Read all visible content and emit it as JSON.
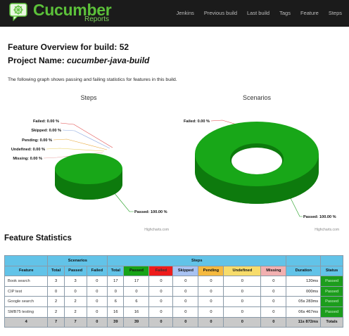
{
  "header": {
    "logo_title": "Cucumber",
    "logo_subtitle": "Reports",
    "nav": [
      "Jenkins",
      "Previous build",
      "Last build",
      "Tags",
      "Feature",
      "Steps"
    ]
  },
  "overview": {
    "build_heading": "Feature Overview for build: 52",
    "project_label": "Project Name: ",
    "project_name": "cucumber-java-build",
    "description": "The following graph shows passing and failing statistics for features in this build."
  },
  "charts": {
    "steps_title": "Steps",
    "scenarios_title": "Scenarios",
    "credit": "Highcharts.com",
    "steps_labels": {
      "failed": "Failed: 0.00 %",
      "skipped": "Skipped: 0.00 %",
      "pending": "Pending: 0.00 %",
      "undefined": "Undefined: 0.00 %",
      "missing": "Missing: 0.00 %",
      "passed": "Passed: 100.00 %"
    },
    "scenarios_labels": {
      "failed": "Failed: 0.00 %",
      "passed": "Passed: 100.00 %"
    }
  },
  "chart_data": [
    {
      "type": "pie",
      "title": "Steps",
      "categories": [
        "Failed",
        "Skipped",
        "Pending",
        "Undefined",
        "Missing",
        "Passed"
      ],
      "values": [
        0.0,
        0.0,
        0.0,
        0.0,
        0.0,
        100.0
      ],
      "unit": "%"
    },
    {
      "type": "pie",
      "title": "Scenarios",
      "categories": [
        "Failed",
        "Passed"
      ],
      "values": [
        0.0,
        100.0
      ],
      "unit": "%"
    }
  ],
  "stats": {
    "heading": "Feature Statistics",
    "group_headers": {
      "scenarios": "Scenarios",
      "steps": "Steps"
    },
    "columns": {
      "feature": "Feature",
      "sc_total": "Total",
      "sc_passed": "Passed",
      "sc_failed": "Failed",
      "st_total": "Total",
      "st_passed": "Passed",
      "st_failed": "Failed",
      "st_skipped": "Skipped",
      "st_pending": "Pending",
      "st_undefined": "Undefined",
      "st_missing": "Missing",
      "duration": "Duration",
      "status": "Status"
    },
    "rows": [
      {
        "feature": "Book search",
        "sc_total": "3",
        "sc_passed": "3",
        "sc_failed": "0",
        "st_total": "17",
        "st_passed": "17",
        "st_failed": "0",
        "st_skipped": "0",
        "st_pending": "0",
        "st_undefined": "0",
        "st_missing": "0",
        "duration": "120ms",
        "status": "Passed"
      },
      {
        "feature": "CIP test",
        "sc_total": "0",
        "sc_passed": "0",
        "sc_failed": "0",
        "st_total": "0",
        "st_passed": "0",
        "st_failed": "0",
        "st_skipped": "0",
        "st_pending": "0",
        "st_undefined": "0",
        "st_missing": "0",
        "duration": "000ms",
        "status": "Passed"
      },
      {
        "feature": "Google search",
        "sc_total": "2",
        "sc_passed": "2",
        "sc_failed": "0",
        "st_total": "6",
        "st_passed": "6",
        "st_failed": "0",
        "st_skipped": "0",
        "st_pending": "0",
        "st_undefined": "0",
        "st_missing": "0",
        "duration": "05s 283ms",
        "status": "Passed"
      },
      {
        "feature": "SMB75 testing",
        "sc_total": "2",
        "sc_passed": "2",
        "sc_failed": "0",
        "st_total": "16",
        "st_passed": "16",
        "st_failed": "0",
        "st_skipped": "0",
        "st_pending": "0",
        "st_undefined": "0",
        "st_missing": "0",
        "duration": "06s 467ms",
        "status": "Passed"
      }
    ],
    "totals": {
      "feature": "4",
      "sc_total": "7",
      "sc_passed": "7",
      "sc_failed": "0",
      "st_total": "39",
      "st_passed": "39",
      "st_failed": "0",
      "st_skipped": "0",
      "st_pending": "0",
      "st_undefined": "0",
      "st_missing": "0",
      "duration": "11s 872ms",
      "status": "Totals"
    }
  },
  "colors": {
    "passed": "#17a317",
    "failed": "#ee1c1c",
    "skipped": "#a8c2f2",
    "pending": "#f5b93f",
    "undefined": "#f7dc6b",
    "missing": "#f2b0b0",
    "header_bg": "#62c3e8",
    "logo_green": "#5cc13a"
  }
}
